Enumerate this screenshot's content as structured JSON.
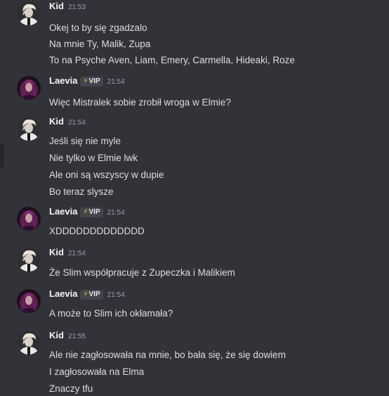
{
  "messages": [
    {
      "author": "Kid",
      "time": "21:53",
      "avatar": "kid",
      "badge": null,
      "lines": [
        "Okej to by się zgadzalo",
        "Na mnie Ty, Malik, Zupa",
        "To na Psyche Aven, Liam, Emery, Carmella, Hideaki, Roze"
      ]
    },
    {
      "author": "Laevia",
      "time": "21:54",
      "avatar": "laevia",
      "badge": "VIP",
      "lines": [
        "Więc Mistralek sobie zrobił wroga w Elmie?"
      ]
    },
    {
      "author": "Kid",
      "time": "21:54",
      "avatar": "kid",
      "badge": null,
      "lines": [
        "Jeśli się nie myle",
        "Nie tylko w Elmie lwk",
        "Ale oni są wszyscy w dupie",
        "Bo teraz slysze"
      ]
    },
    {
      "author": "Laevia",
      "time": "21:54",
      "avatar": "laevia",
      "badge": "VIP",
      "lines": [
        "XDDDDDDDDDDDDD"
      ]
    },
    {
      "author": "Kid",
      "time": "21:54",
      "avatar": "kid",
      "badge": null,
      "lines": [
        "Że Slim współpracuje z Zupeczka i Malikiem"
      ]
    },
    {
      "author": "Laevia",
      "time": "21:54",
      "avatar": "laevia",
      "badge": "VIP",
      "lines": [
        "A może to Slim ich okłamała?"
      ]
    },
    {
      "author": "Kid",
      "time": "21:55",
      "avatar": "kid",
      "badge": null,
      "lines": [
        "Ale nie zagłosowała na mnie, bo bała się, że się dowiem",
        "I zagłosowała na Elma",
        "Znaczy tfu"
      ]
    }
  ],
  "colors": {
    "background": "#323339",
    "username": "#f2f3f5",
    "text": "#dbdee1",
    "timestamp": "#9a9ca4",
    "badge_bg": "#44454c",
    "bolt": "#f5c518"
  },
  "icons": {
    "badge": "lightning-bolt-icon"
  }
}
